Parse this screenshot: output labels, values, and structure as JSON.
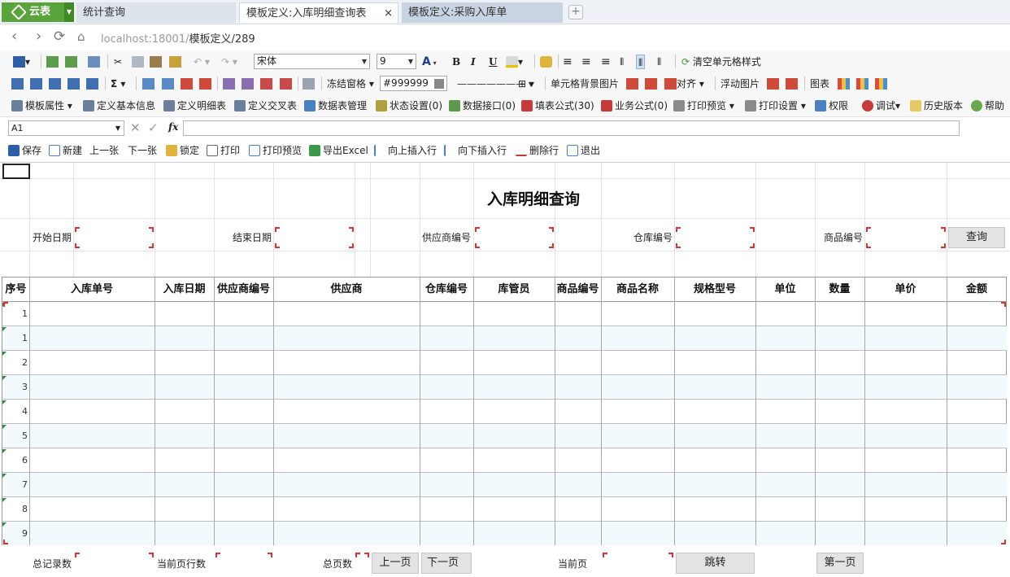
{
  "app": {
    "name": "云表"
  },
  "tabs": [
    {
      "label": "统计查询"
    },
    {
      "label": "模板定义:入库明细查询表",
      "close": "×"
    },
    {
      "label": "模板定义:采购入库单"
    }
  ],
  "address": {
    "prefix": "localhost:",
    "host": "18001/",
    "path": "模板定义",
    "suffix": "/289"
  },
  "toolbar1": {
    "font": "宋体",
    "size": "9",
    "clear_style": "清空单元格样式"
  },
  "toolbar2": {
    "freeze": "冻结窗格",
    "color": "#999999",
    "cell_bg": "单元格背景图片",
    "align": "对齐",
    "float_img": "浮动图片",
    "chart": "图表"
  },
  "toolbar3": {
    "items": [
      "模板属性",
      "定义基本信息",
      "定义明细表",
      "定义交叉表",
      "数据表管理",
      "状态设置(0)",
      "数据接口(0)",
      "填表公式(30)",
      "业务公式(0)",
      "打印预览",
      "打印设置",
      "权限",
      "调试",
      "历史版本",
      "帮助"
    ]
  },
  "formula": {
    "cell": "A1",
    "fx": "fx"
  },
  "actions": [
    "保存",
    "新建",
    "上一张",
    "下一张",
    "锁定",
    "打印",
    "打印预览",
    "导出Excel",
    "向上插入行",
    "向下插入行",
    "删除行",
    "退出"
  ],
  "sheet": {
    "title": "入库明细查询",
    "filters": {
      "start": "开始日期",
      "end": "结束日期",
      "supplier": "供应商编号",
      "warehouse": "仓库编号",
      "product": "商品编号",
      "query": "查询"
    },
    "columns": [
      "序号",
      "入库单号",
      "入库日期",
      "供应商编号",
      "供应商",
      "仓库编号",
      "库管员",
      "商品编号",
      "商品名称",
      "规格型号",
      "单位",
      "数量",
      "单价",
      "金额"
    ],
    "row_numbers": [
      "1",
      "1",
      "2",
      "3",
      "4",
      "5",
      "6",
      "7",
      "8",
      "9"
    ],
    "footer": {
      "total": "总记录数",
      "rows_per_page": "当前页行数",
      "pages": "总页数",
      "prev": "上一页",
      "next": "下一页",
      "current": "当前页",
      "jump": "跳转",
      "first": "第一页"
    }
  },
  "colors": {
    "brand": "#5aa43c",
    "accent_red": "#e03030",
    "alt_row": "#f3fafe"
  }
}
